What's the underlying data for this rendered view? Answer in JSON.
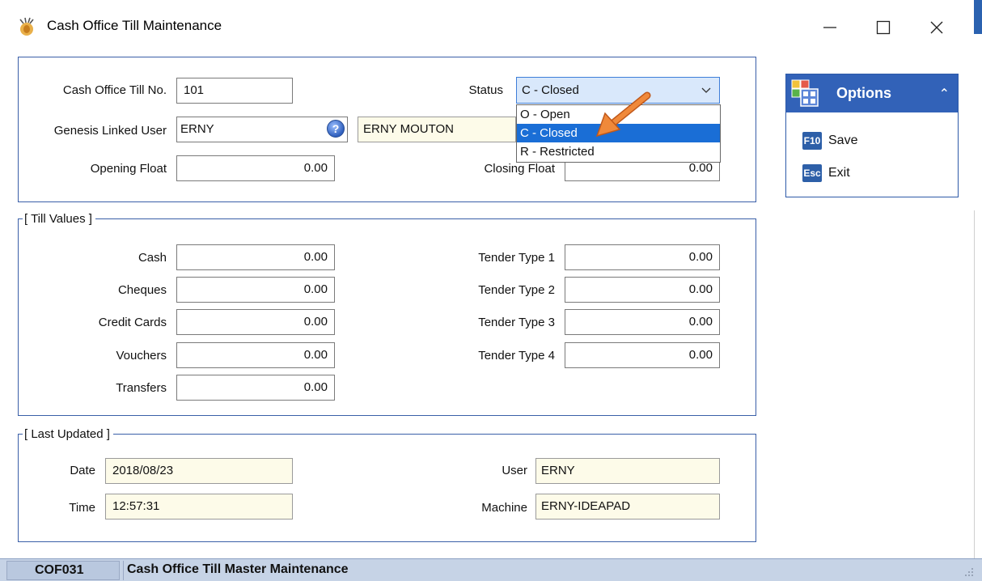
{
  "window": {
    "title": "Cash Office Till Maintenance",
    "minimize_glyph": "minimize-icon",
    "maximize_glyph": "maximize-icon",
    "close_glyph": "close-icon"
  },
  "details": {
    "till_no_label": "Cash Office Till No.",
    "till_no_value": "101",
    "status_label": "Status",
    "status_value": "C - Closed",
    "status_options": [
      "O - Open",
      "C - Closed",
      "R - Restricted"
    ],
    "linked_user_label": "Genesis Linked User",
    "linked_user_code": "ERNY",
    "linked_user_name": "ERNY MOUTON",
    "opening_float_label": "Opening Float",
    "opening_float_value": "0.00",
    "closing_float_label": "Closing Float",
    "closing_float_value": "0.00"
  },
  "till_values": {
    "group_label": "[ Till Values ]",
    "cash_label": "Cash",
    "cash_value": "0.00",
    "cheques_label": "Cheques",
    "cheques_value": "0.00",
    "credit_cards_label": "Credit Cards",
    "credit_cards_value": "0.00",
    "vouchers_label": "Vouchers",
    "vouchers_value": "0.00",
    "transfers_label": "Transfers",
    "transfers_value": "0.00",
    "tender1_label": "Tender Type 1",
    "tender1_value": "0.00",
    "tender2_label": "Tender Type 2",
    "tender2_value": "0.00",
    "tender3_label": "Tender Type 3",
    "tender3_value": "0.00",
    "tender4_label": "Tender Type 4",
    "tender4_value": "0.00"
  },
  "last_updated": {
    "group_label": "[ Last Updated ]",
    "date_label": "Date",
    "date_value": "2018/08/23",
    "time_label": "Time",
    "time_value": "12:57:31",
    "user_label": "User",
    "user_value": "ERNY",
    "machine_label": "Machine",
    "machine_value": "ERNY-IDEAPAD"
  },
  "options": {
    "title": "Options",
    "save_key": "F10",
    "save_label": "Save",
    "exit_key": "Esc",
    "exit_label": "Exit"
  },
  "statusbar": {
    "code": "COF031",
    "text": "Cash Office Till Master Maintenance"
  },
  "colors": {
    "accent": "#3262b8",
    "selection": "#1a6ed6",
    "readonly_bg": "#fdfbe9",
    "arrow": "#e87a2a"
  }
}
